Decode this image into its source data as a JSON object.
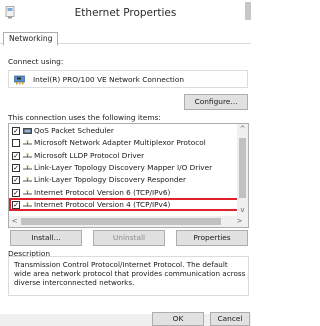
{
  "window": {
    "title": "Ethernet Properties"
  },
  "tabs": [
    {
      "label": "Networking"
    }
  ],
  "connect": {
    "label": "Connect using:",
    "adapter_name": "Intel(R) PRO/100 VE Network Connection",
    "configure_label": "Configure..."
  },
  "items_section": {
    "label": "This connection uses the following items:",
    "items": [
      {
        "label": "QoS Packet Scheduler",
        "checked": true,
        "icon": "network-service-icon"
      },
      {
        "label": "Microsoft Network Adapter Multiplexor Protocol",
        "checked": false,
        "icon": "protocol-icon"
      },
      {
        "label": "Microsoft LLDP Protocol Driver",
        "checked": true,
        "icon": "protocol-icon"
      },
      {
        "label": "Link-Layer Topology Discovery Mapper I/O Driver",
        "checked": true,
        "icon": "protocol-icon"
      },
      {
        "label": "Link-Layer Topology Discovery Responder",
        "checked": true,
        "icon": "protocol-icon"
      },
      {
        "label": "Internet Protocol Version 6 (TCP/IPv6)",
        "checked": true,
        "icon": "protocol-icon"
      },
      {
        "label": "Internet Protocol Version 4 (TCP/IPv4)",
        "checked": true,
        "icon": "protocol-icon",
        "highlighted": true
      }
    ]
  },
  "buttons": {
    "install": "Install...",
    "uninstall": "Uninstall",
    "properties": "Properties",
    "ok": "OK",
    "cancel": "Cancel"
  },
  "description": {
    "title": "Description",
    "text": "Transmission Control Protocol/Internet Protocol. The default wide area network protocol that provides communication across diverse interconnected networks."
  },
  "colors": {
    "highlight_border": "#e0202a",
    "button_bg": "#e1e1e1",
    "footer_bg": "#f0f0f0"
  }
}
